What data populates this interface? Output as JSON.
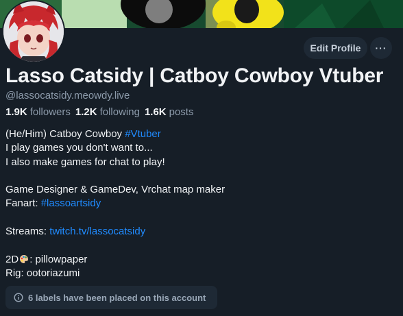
{
  "profile": {
    "display_name": "Lasso Catsidy | Catboy Cowboy Vtuber",
    "handle": "@lassocatsidy.meowdy.live",
    "stats": {
      "followers_count": "1.9K",
      "followers_label": "followers",
      "following_count": "1.2K",
      "following_label": "following",
      "posts_count": "1.6K",
      "posts_label": "posts"
    },
    "bio": {
      "line1_text": "(He/Him) Catboy Cowboy ",
      "line1_tag": "#Vtuber",
      "line2": "I play games you don't want to...",
      "line3": "I also make games for chat to play!",
      "line4": "Game Designer & GameDev, Vrchat map maker",
      "line5_text": "Fanart: ",
      "line5_tag": "#lassoartsidy",
      "line6_text": "Streams: ",
      "line6_link": "twitch.tv/lassocatsidy",
      "line7_prefix": "2D",
      "line7_suffix": ": pillowpaper",
      "line8": "Rig: ootoriazumi"
    }
  },
  "actions": {
    "edit_profile": "Edit Profile",
    "more": "···"
  },
  "labels_notice": "6 labels have been placed on this account",
  "icons": {
    "more": "ellipsis-icon",
    "info": "info-circle-icon",
    "palette": "artist-palette-icon"
  },
  "colors": {
    "background": "#161e27",
    "link": "#208bfe",
    "button": "#1e2935",
    "muted": "#8d9bab"
  }
}
